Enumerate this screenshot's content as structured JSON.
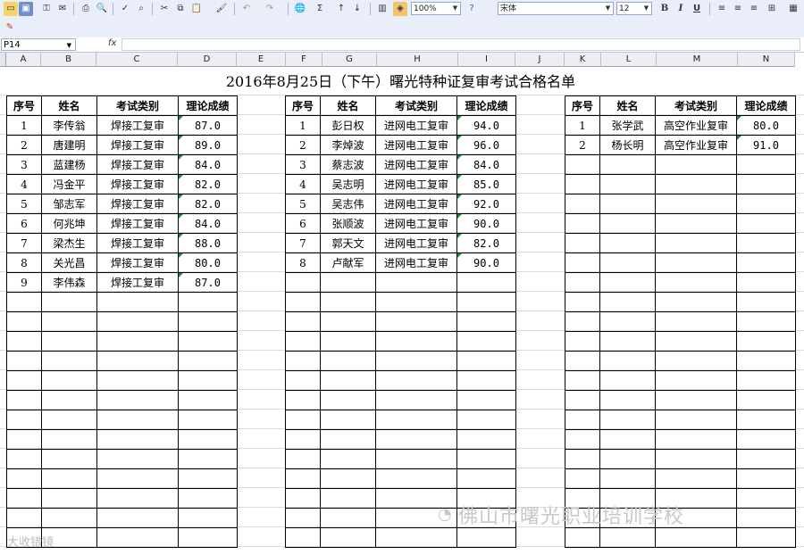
{
  "toolbar": {
    "zoom": "100%",
    "font_name": "宋体",
    "font_size": "12",
    "bold": "B",
    "italic": "I",
    "underline": "U"
  },
  "formula_bar": {
    "cell_ref": "P14",
    "fx": "fx",
    "content": ""
  },
  "columns": [
    "A",
    "B",
    "C",
    "D",
    "E",
    "F",
    "G",
    "H",
    "I",
    "J",
    "K",
    "L",
    "M",
    "N"
  ],
  "title": "2016年8月25日（下午）曙光特种证复审考试合格名单",
  "headers": [
    "序号",
    "姓名",
    "考试类别",
    "理论成绩"
  ],
  "block1": [
    [
      "1",
      "李传翁",
      "焊接工复审",
      "87.0"
    ],
    [
      "2",
      "唐建明",
      "焊接工复审",
      "89.0"
    ],
    [
      "3",
      "蓝建杨",
      "焊接工复审",
      "84.0"
    ],
    [
      "4",
      "冯金平",
      "焊接工复审",
      "82.0"
    ],
    [
      "5",
      "邹志军",
      "焊接工复审",
      "82.0"
    ],
    [
      "6",
      "何兆坤",
      "焊接工复审",
      "84.0"
    ],
    [
      "7",
      "梁杰生",
      "焊接工复审",
      "88.0"
    ],
    [
      "8",
      "关光昌",
      "焊接工复审",
      "80.0"
    ],
    [
      "9",
      "李伟森",
      "焊接工复审",
      "87.0"
    ]
  ],
  "block2": [
    [
      "1",
      "彭日权",
      "进网电工复审",
      "94.0"
    ],
    [
      "2",
      "李焯波",
      "进网电工复审",
      "96.0"
    ],
    [
      "3",
      "蔡志波",
      "进网电工复审",
      "84.0"
    ],
    [
      "4",
      "吴志明",
      "进网电工复审",
      "85.0"
    ],
    [
      "5",
      "吴志伟",
      "进网电工复审",
      "92.0"
    ],
    [
      "6",
      "张顺波",
      "进网电工复审",
      "90.0"
    ],
    [
      "7",
      "郭天文",
      "进网电工复审",
      "82.0"
    ],
    [
      "8",
      "卢献军",
      "进网电工复审",
      "90.0"
    ]
  ],
  "block3": [
    [
      "1",
      "张学武",
      "高空作业复审",
      "80.0"
    ],
    [
      "2",
      "杨长明",
      "高空作业复审",
      "91.0"
    ]
  ],
  "watermark": "佛山市曙光职业培训学校",
  "watermark2": "大收错镜"
}
